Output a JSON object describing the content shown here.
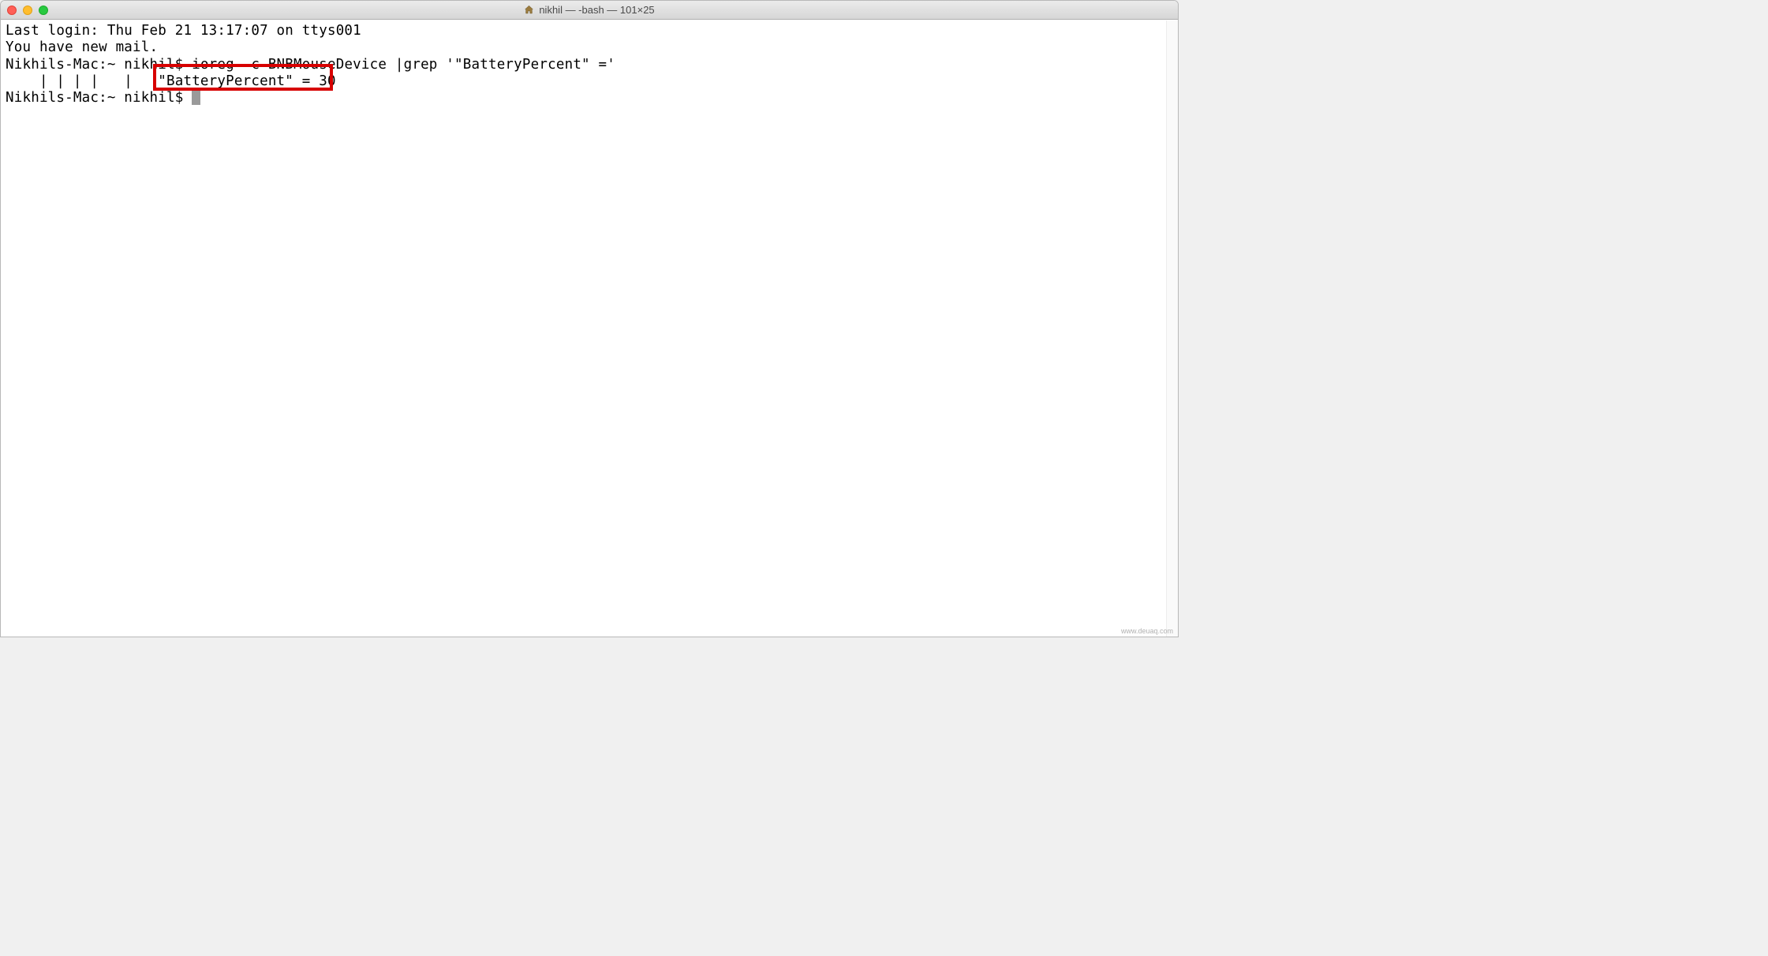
{
  "window": {
    "title": "nikhil — -bash — 101×25"
  },
  "terminal": {
    "lines": {
      "last_login": "Last login: Thu Feb 21 13:17:07 on ttys001",
      "mail_notice": "You have new mail.",
      "prompt1_host": "Nikhils-Mac:~ nikhil$ ",
      "command1": "ioreg -c BNBMouseDevice |grep '\"BatteryPercent\" ='",
      "output_prefix": "    | | | |   |   ",
      "output_highlight": "\"BatteryPercent\" = 30",
      "prompt2_host": "Nikhils-Mac:~ nikhil$ "
    }
  },
  "watermark": "www.deuaq.com"
}
